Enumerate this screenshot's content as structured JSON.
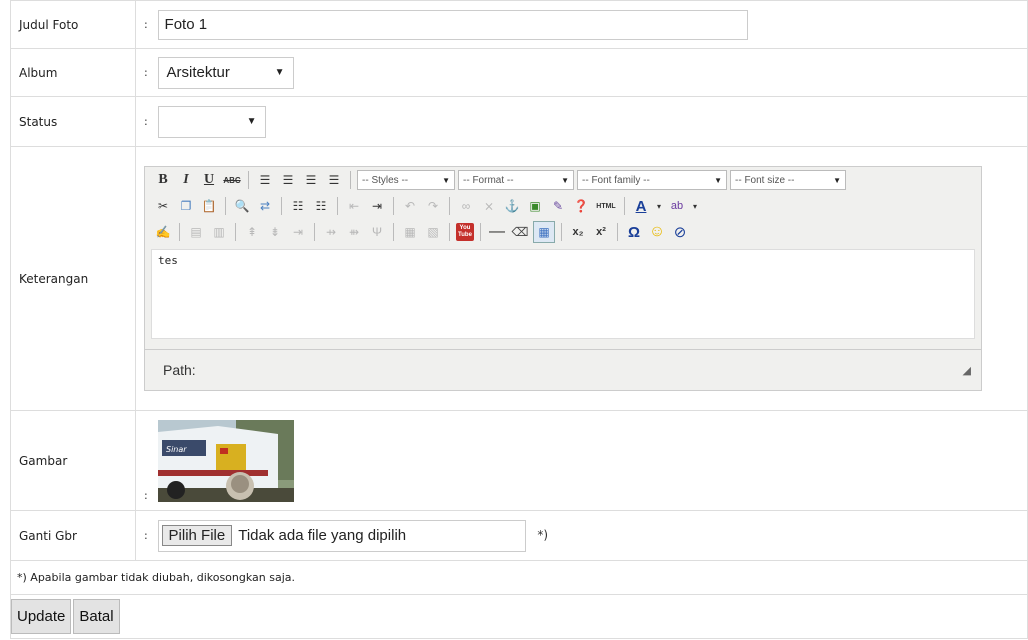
{
  "form": {
    "judul": {
      "label": "Judul Foto",
      "value": "Foto 1"
    },
    "album": {
      "label": "Album",
      "selected": "Arsitektur"
    },
    "status": {
      "label": "Status",
      "selected": ""
    },
    "keterangan": {
      "label": "Keterangan",
      "editor": {
        "dropdowns": {
          "styles": "-- Styles --",
          "format": "-- Format --",
          "font_family": "-- Font family --",
          "font_size": "-- Font size --"
        },
        "content": "tes",
        "path_label": "Path:",
        "buttons": {
          "bold": "B",
          "italic": "I",
          "underline": "U",
          "strike": "ABC",
          "html": "HTML",
          "youtube": "You Tube",
          "omega": "Ω",
          "subscript": "x₂",
          "superscript": "x²"
        }
      }
    },
    "gambar": {
      "label": "Gambar"
    },
    "ganti": {
      "label": "Ganti Gbr",
      "button": "Pilih File",
      "status": "Tidak ada file yang dipilih",
      "note": "*)"
    },
    "footnote": "*) Apabila gambar tidak diubah, dikosongkan saja.",
    "actions": {
      "update": "Update",
      "batal": "Batal"
    },
    "colon": ":"
  },
  "colors": {
    "border": "#dddddd",
    "editor_bg": "#f0f0ee",
    "button_bg": "#e3e3e3"
  }
}
